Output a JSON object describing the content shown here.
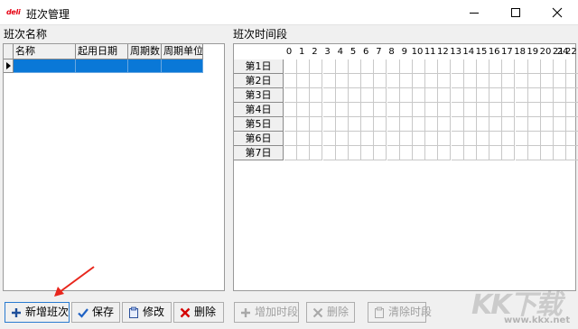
{
  "window": {
    "logo": "deli",
    "title": "班次管理"
  },
  "left_panel": {
    "title": "班次名称",
    "columns": [
      "名称",
      "起用日期",
      "周期数",
      "周期单位"
    ]
  },
  "right_panel": {
    "title": "班次时间段",
    "hours": [
      "0",
      "1",
      "2",
      "3",
      "4",
      "5",
      "6",
      "7",
      "8",
      "9",
      "10",
      "11",
      "12",
      "13",
      "14",
      "15",
      "16",
      "17",
      "18",
      "19",
      "20",
      "21",
      "22",
      "23"
    ],
    "trailing_hour": "24",
    "days": [
      "第1日",
      "第2日",
      "第3日",
      "第4日",
      "第5日",
      "第6日",
      "第7日"
    ]
  },
  "buttons": {
    "add_shift": "新增班次",
    "save": "保存",
    "edit": "修改",
    "delete": "删除",
    "add_period": "增加时段",
    "delete_period": "删除",
    "clear_period": "清除时段"
  },
  "icons": {
    "add": "plus-icon",
    "save": "check-icon",
    "edit": "clipboard-icon",
    "delete": "x-icon",
    "clear": "clipboard-icon"
  },
  "colors": {
    "selected_row": "#0a78d7",
    "logo": "#e60012",
    "delete_icon": "#d40000",
    "arrow": "#e8261c"
  },
  "watermark": {
    "logo": "KK下载",
    "url": "www.kkx.net"
  }
}
